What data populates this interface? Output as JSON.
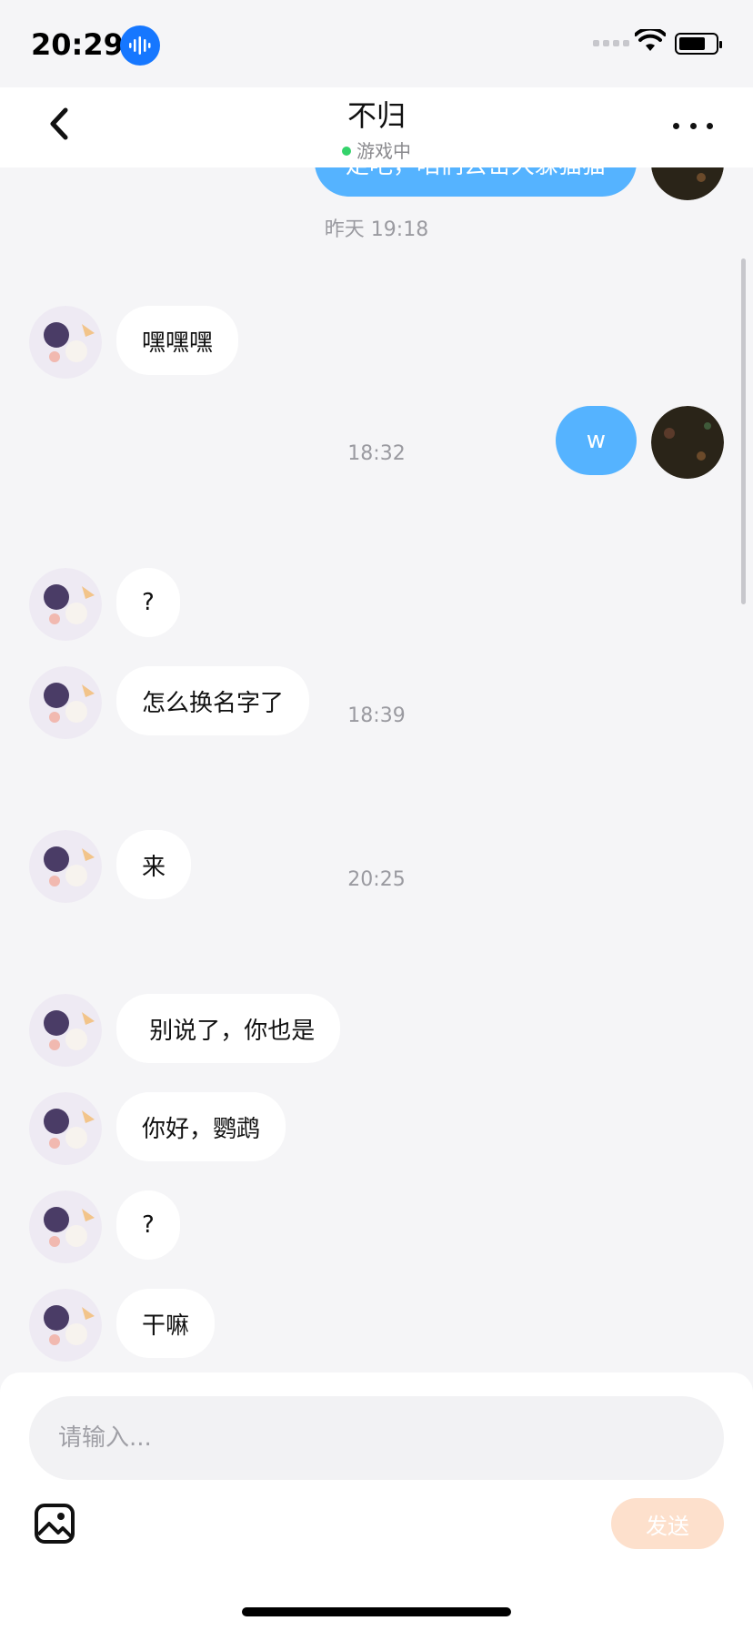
{
  "status_bar": {
    "time": "20:29"
  },
  "header": {
    "title": "不归",
    "status": "游戏中",
    "status_color": "#34d36b"
  },
  "chat": {
    "partially_visible_message": "走吧，咱们去密大躲猫猫",
    "timestamps": [
      "昨天 19:18",
      "18:32",
      "18:39",
      "20:25"
    ],
    "messages": [
      {
        "from": "them",
        "text": "嘿嘿嘿"
      },
      {
        "from": "me",
        "text": "w"
      },
      {
        "from": "them",
        "text": "?"
      },
      {
        "from": "them",
        "text": "怎么换名字了"
      },
      {
        "from": "them",
        "text": "来"
      },
      {
        "from": "them",
        "text": " 别说了，你也是"
      },
      {
        "from": "them",
        "text": "你好，鹦鹉"
      },
      {
        "from": "them",
        "text": "?"
      },
      {
        "from": "them",
        "text": "干嘛"
      }
    ]
  },
  "composer": {
    "placeholder": "请输入...",
    "send_label": "发送",
    "send_color": "#fde0cc"
  },
  "icons": [
    "mic-badge-icon",
    "signal-icon",
    "wifi-icon",
    "battery-icon",
    "back-chevron-icon",
    "more-icon",
    "image-icon"
  ],
  "colors": {
    "outgoing_bubble": "#55b3ff",
    "incoming_bubble": "#ffffff",
    "accent": "#1677ff"
  }
}
